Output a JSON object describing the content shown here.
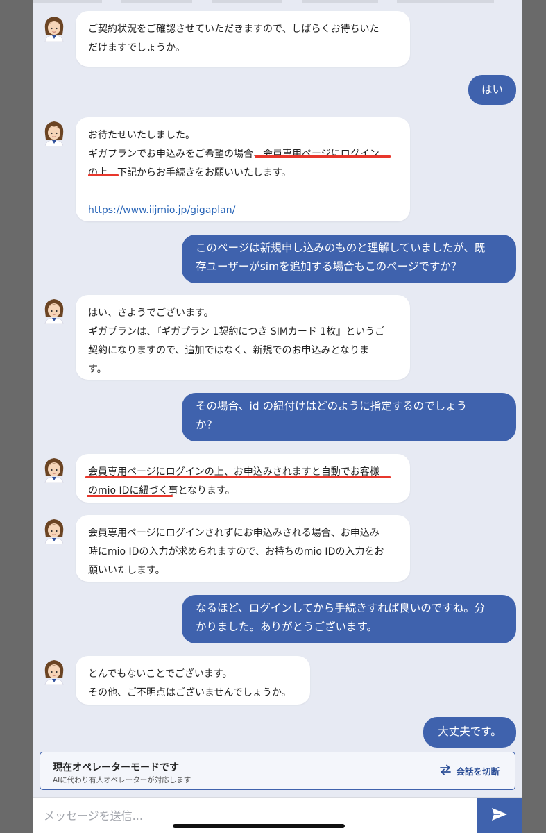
{
  "messages": [
    {
      "from": "operator",
      "lines": [
        "ご契約状況をご確認させていただきますので、しばらくお待ちいた",
        "だけますでしょうか。"
      ]
    },
    {
      "from": "user",
      "lines": [
        "はい"
      ]
    },
    {
      "from": "operator",
      "lines": [
        "お待たせいたしました。",
        "ギガプランでお申込みをご希望の場合、",
        "会員専用ページにログイン",
        "の上、",
        "下記からお手続きをお願いいたします。",
        "https://www.iijmio.jp/gigaplan/"
      ]
    },
    {
      "from": "user",
      "lines": [
        "このページは新規申し込みのものと理解していましたが、既",
        "存ユーザーがsimを追加する場合もこのページですか？"
      ]
    },
    {
      "from": "operator",
      "lines": [
        "はい、さようでございます。",
        "ギガプランは、『ギガプラン 1契約につき SIMカード 1枚』というご",
        "契約になりますので、追加ではなく、新規でのお申込みとなりま",
        "す。"
      ]
    },
    {
      "from": "user",
      "lines": [
        "その場合、id の紐付けはどのように指定するのでしょう",
        "か？"
      ]
    },
    {
      "from": "operator",
      "lines": [
        "会員専用ページにログインの上、お申込みされますと自動でお客様",
        "のmio IDに紐づく事",
        "となります。"
      ]
    },
    {
      "from": "operator",
      "lines": [
        "会員専用ページにログインされずにお申込みされる場合、お申込み",
        "時にmio IDの入力が求められますので、お持ちのmio IDの入力をお",
        "願いいたします。"
      ]
    },
    {
      "from": "user",
      "lines": [
        "なるほど、ログインしてから手続きすれば良いのですね。分",
        "かりました。ありがとうございます。"
      ]
    },
    {
      "from": "operator",
      "lines": [
        "とんでもないことでございます。",
        "その他、ご不明点はございませんでしょうか。"
      ]
    },
    {
      "from": "user",
      "lines": [
        "大丈夫です。"
      ]
    }
  ],
  "operator_banner": {
    "title": "現在オペレーターモードです",
    "subtitle": "AIに代わり有人オペレーターが対応します",
    "disconnect_label": "会話を切断"
  },
  "composer": {
    "placeholder": "メッセージを送信...",
    "send_icon": "send-icon"
  },
  "colors": {
    "user_bubble": "#3f62ad",
    "operator_bubble": "#ffffff",
    "chat_background": "#e7eaf3",
    "annotation_underline": "#e8372c",
    "link": "#2a66b8"
  }
}
